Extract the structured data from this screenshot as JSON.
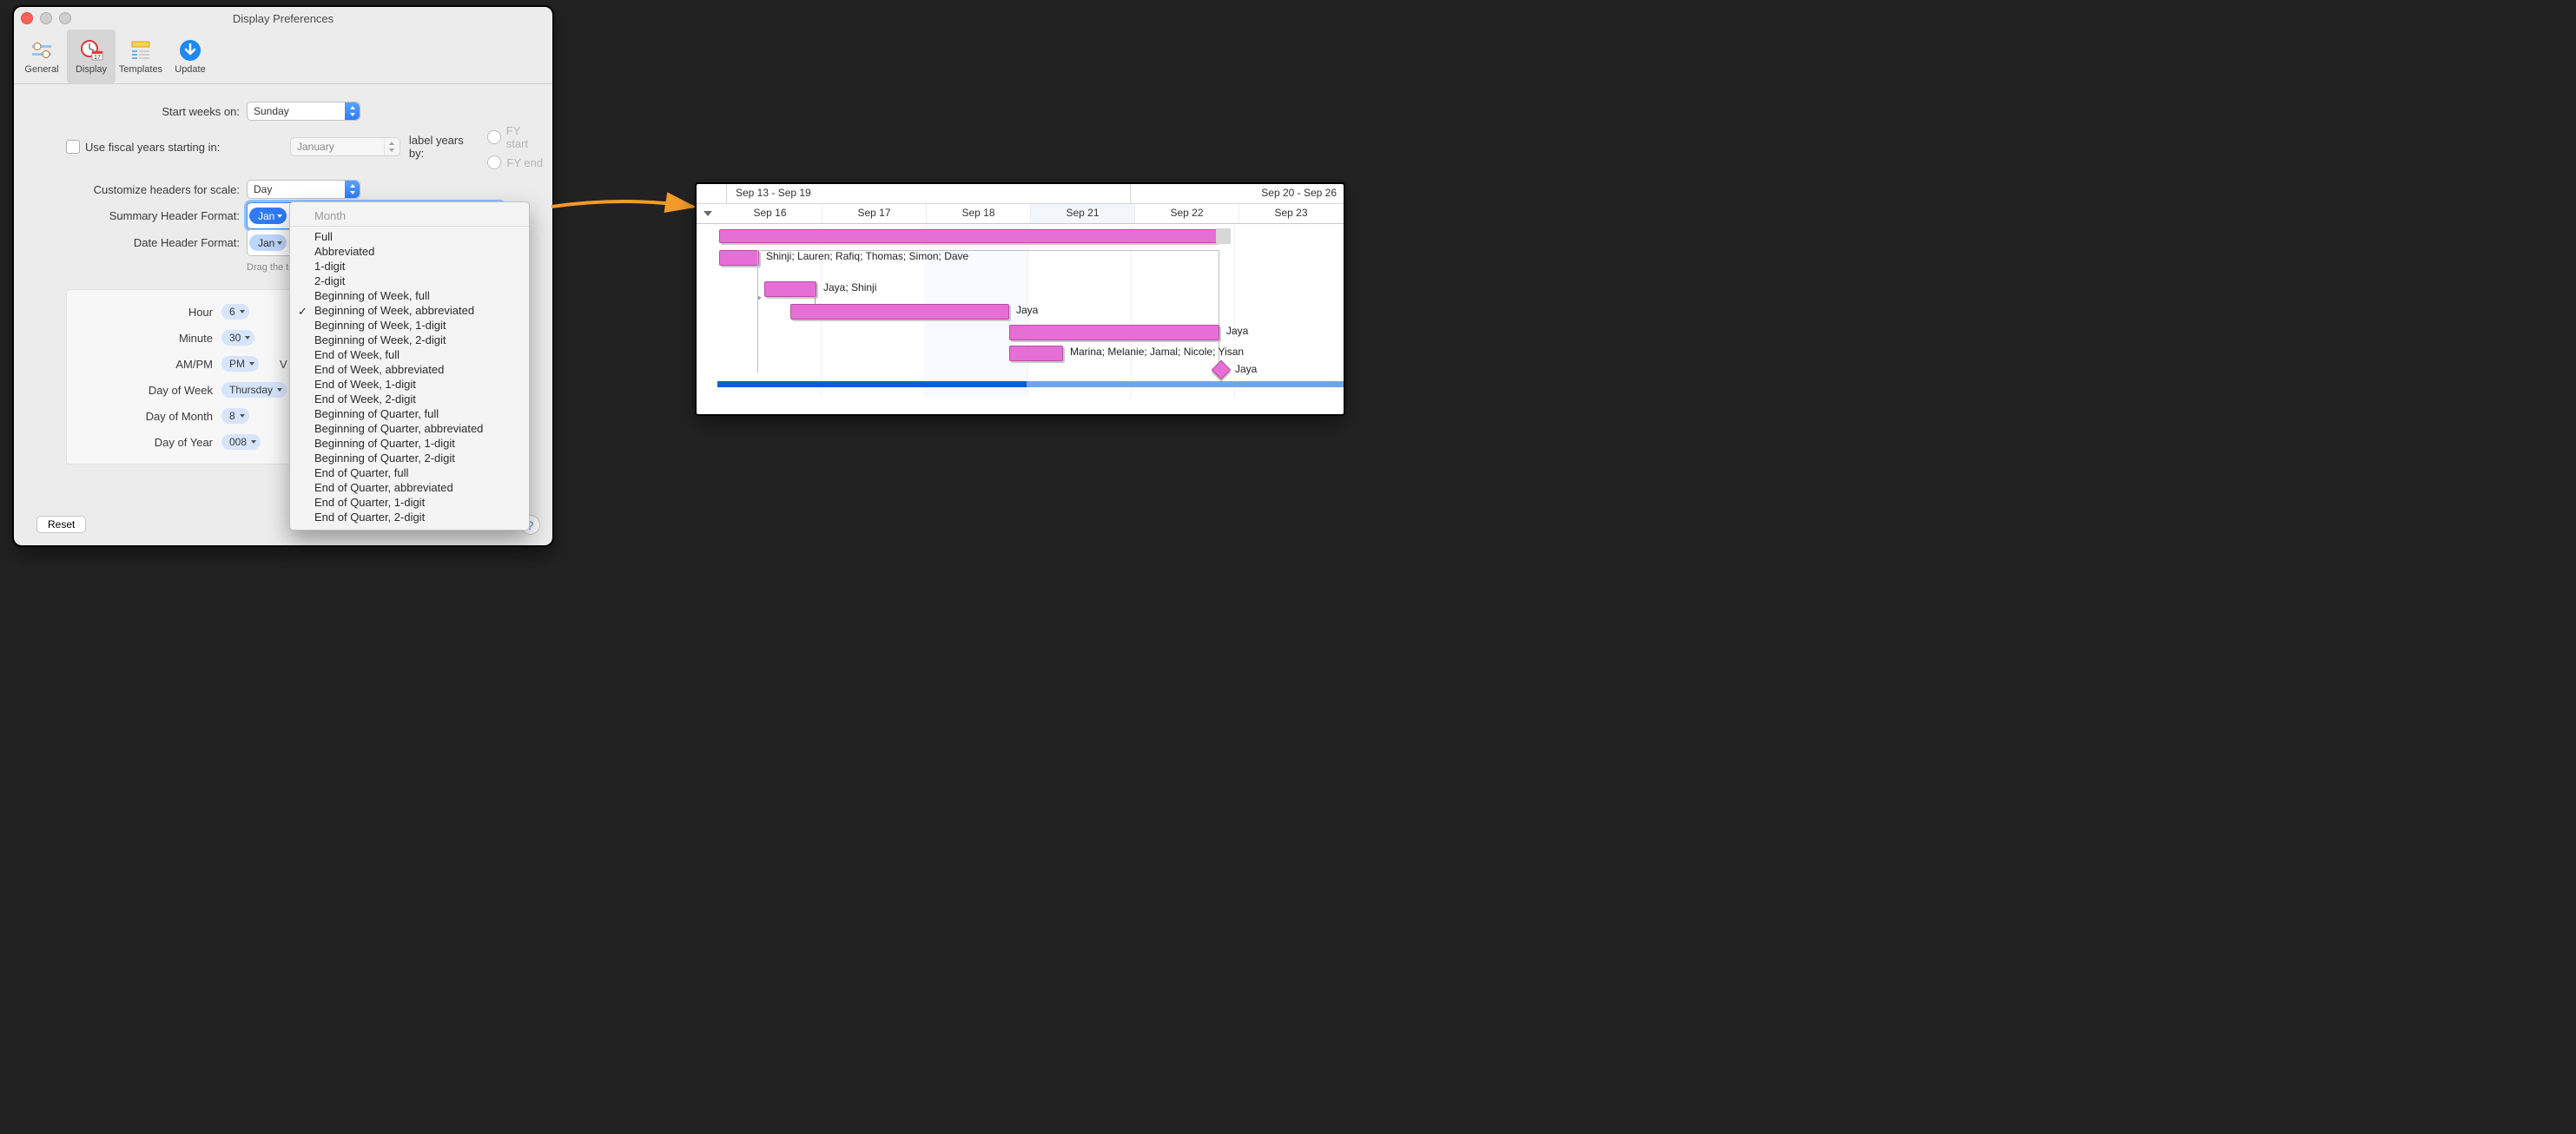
{
  "window": {
    "title": "Display Preferences",
    "toolbar": [
      {
        "label": "General",
        "icon": "sliders"
      },
      {
        "label": "Display",
        "icon": "clock-cal"
      },
      {
        "label": "Templates",
        "icon": "ruler-list"
      },
      {
        "label": "Update",
        "icon": "download"
      }
    ],
    "selected_tab": "Display"
  },
  "form": {
    "start_weeks_label": "Start weeks on:",
    "start_weeks_value": "Sunday",
    "fiscal_check_label": "Use fiscal years starting in:",
    "fiscal_month": "January",
    "label_years_label": "label years by:",
    "fy_start": "FY start",
    "fy_end": "FY end",
    "scale_label": "Customize headers for scale:",
    "scale_value": "Day",
    "summary_label": "Summary Header Format:",
    "date_label": "Date Header Format:",
    "drag_hint": "Drag the tokens you ",
    "token_jan": "Jan",
    "mini": {
      "hour_lab": "Hour",
      "hour": "6",
      "minute_lab": "Minute",
      "minute": "30",
      "ampm_lab": "AM/PM",
      "ampm": "PM",
      "dow_lab": "Day of Week",
      "dow": "Thursday",
      "dom_lab": "Day of Month",
      "dom": "8",
      "doy_lab": "Day of Year",
      "doy": "008"
    },
    "side_letter": "V",
    "reset": "Reset"
  },
  "menu": {
    "heading": "Month",
    "selected": "Beginning of Week, abbreviated",
    "items": [
      "Full",
      "Abbreviated",
      "1-digit",
      "2-digit",
      "Beginning of Week, full",
      "Beginning of Week, abbreviated",
      "Beginning of Week, 1-digit",
      "Beginning of Week, 2-digit",
      "End of Week, full",
      "End of Week, abbreviated",
      "End of Week, 1-digit",
      "End of Week, 2-digit",
      "Beginning of Quarter, full",
      "Beginning of Quarter, abbreviated",
      "Beginning of Quarter, 1-digit",
      "Beginning of Quarter, 2-digit",
      "End of Quarter, full",
      "End of Quarter, abbreviated",
      "End of Quarter, 1-digit",
      "End of Quarter, 2-digit"
    ]
  },
  "gantt": {
    "summary_left": "Sep 13 - Sep 19",
    "summary_right": "Sep 20 - Sep 26",
    "days": [
      "Sep 16",
      "Sep 17",
      "Sep 18",
      "Sep 21",
      "Sep 22",
      "Sep 23"
    ],
    "rows": [
      {
        "label": "Shinji; Lauren; Rafiq; Thomas; Simon; Dave"
      },
      {
        "label": "Jaya; Shinji"
      },
      {
        "label": "Jaya"
      },
      {
        "label": "Jaya"
      },
      {
        "label": "Marina; Melanie; Jamal; Nicole; Yisan"
      },
      {
        "label": "Jaya"
      }
    ]
  }
}
